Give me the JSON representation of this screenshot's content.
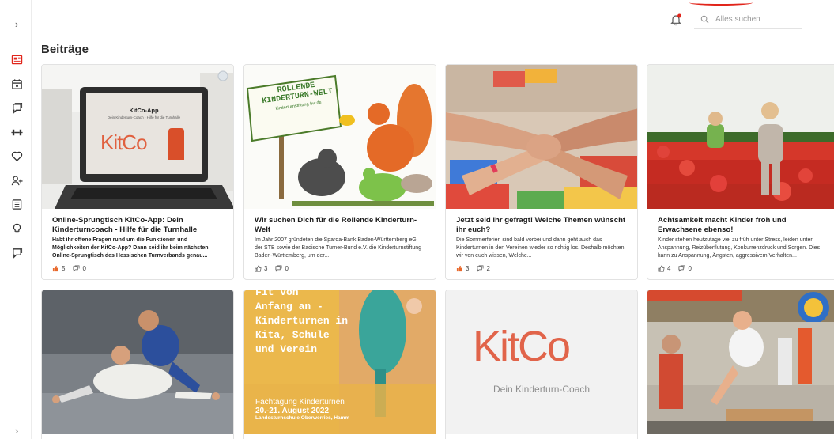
{
  "search": {
    "placeholder": "Alles suchen"
  },
  "page_title": "Beiträge",
  "colors": {
    "accent": "#e1251b",
    "border": "#e2e2e2"
  },
  "sidebar": {
    "items": [
      {
        "icon": "newspaper-icon",
        "active": true
      },
      {
        "icon": "calendar-icon"
      },
      {
        "icon": "chat-icon"
      },
      {
        "icon": "dumbbell-icon"
      },
      {
        "icon": "heart-icon"
      },
      {
        "icon": "add-user-icon"
      },
      {
        "icon": "book-icon"
      },
      {
        "icon": "lightbulb-icon"
      },
      {
        "icon": "chat-bubbles-icon"
      }
    ]
  },
  "cards": [
    {
      "title": "Online-Sprungtisch KitCo-App: Dein Kinderturncoach - Hilfe für die Turnhalle",
      "excerpt": "Habt ihr offene Fragen rund um die Funktionen und Möglichkeiten der KitCo-App? Dann seid ihr beim nächsten Online-Sprungtisch des Hessischen Turnverbands genau...",
      "likes": "5",
      "comments": "0",
      "liked": true,
      "screen_title": "KitCo-App",
      "screen_sub": "Dein Kinderturn-Coach - Hilfe für die Turnhalle",
      "screen_logo": "KitCo"
    },
    {
      "title": "Wir suchen Dich für die Rollende Kinderturn-Welt",
      "excerpt": "Im Jahr 2007 gründeten die Sparda-Bank Baden-Württemberg eG, der STB sowie der Badische Turner-Bund e.V. die Kinderturnstiftung Baden-Württemberg, um der...",
      "likes": "3",
      "comments": "0",
      "liked": false,
      "sign_line1": "ROLLENDE",
      "sign_line2": "KINDERTURN-WELT",
      "sign_url": "kinderturnstiftung-bw.de"
    },
    {
      "title": "Jetzt seid ihr gefragt! Welche Themen wünscht ihr euch?",
      "excerpt": "Die Sommerferien sind bald vorbei und dann geht auch das Kinderturnen in den Vereinen wieder so richtig los. Deshalb möchten wir von euch wissen, Welche...",
      "likes": "3",
      "comments": "2",
      "liked": true
    },
    {
      "title": "Achtsamkeit macht Kinder froh und Erwachsene ebenso!",
      "excerpt": "Kinder stehen heutzutage viel zu früh unter Stress, leiden unter Anspannung, Reizüberflutung, Konkurrenzdruck und Sorgen. Dies kann zu Anspannung, Ängsten, aggressivem Verhalten...",
      "likes": "4",
      "comments": "0",
      "liked": false
    }
  ],
  "cards_row2": [
    {
      "alt": "judo"
    },
    {
      "poster_top": "Fit von",
      "poster_line1": "Anfang an -",
      "poster_line2": "Kinderturnen in",
      "poster_line3": "Kita, Schule",
      "poster_line4": "und Verein",
      "event_title": "Fachtagung Kinderturnen",
      "event_date": "20.-21. August 2022",
      "event_place": "Landesturnschule Oberwerries, Hamm"
    },
    {
      "logo": "KitCo",
      "tagline": "Dein Kinderturn-Coach"
    },
    {
      "alt": "gym"
    }
  ]
}
